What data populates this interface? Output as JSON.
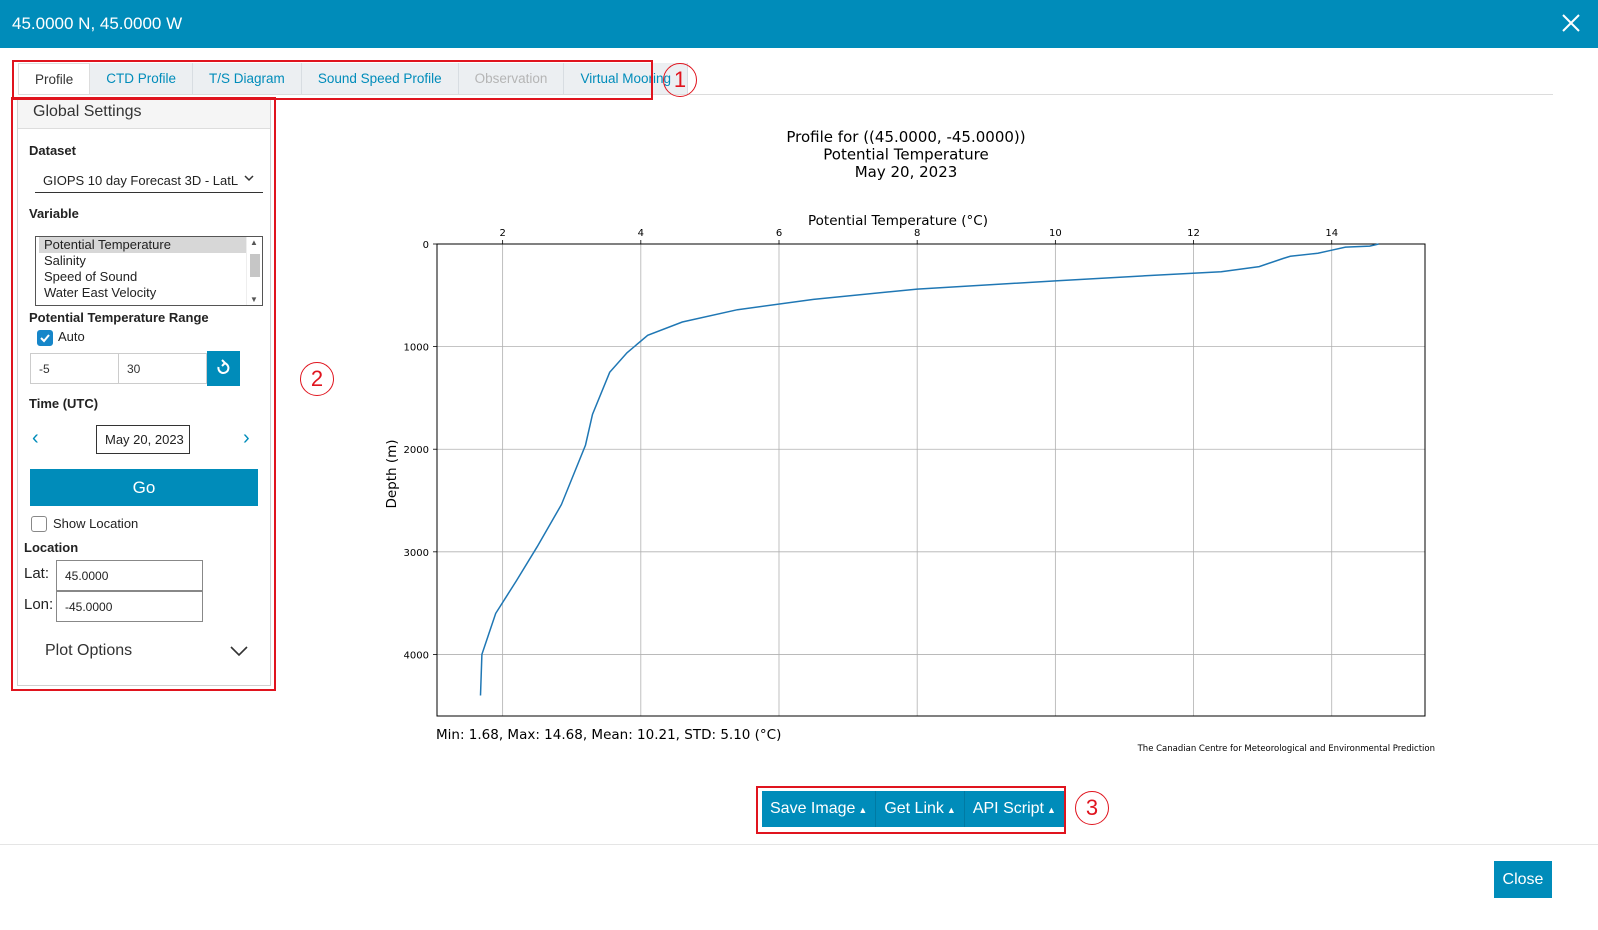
{
  "window": {
    "title": "45.0000 N, 45.0000 W",
    "close_icon": "close-icon"
  },
  "tabs": [
    {
      "label": "Profile",
      "state": "active"
    },
    {
      "label": "CTD Profile",
      "state": "normal"
    },
    {
      "label": "T/S Diagram",
      "state": "normal"
    },
    {
      "label": "Sound Speed Profile",
      "state": "normal"
    },
    {
      "label": "Observation",
      "state": "disabled"
    },
    {
      "label": "Virtual Mooring",
      "state": "normal"
    }
  ],
  "markers": [
    "1",
    "2",
    "3"
  ],
  "settings": {
    "header": "Global Settings",
    "dataset_label": "Dataset",
    "dataset_value": "GIOPS 10 day Forecast 3D - LatL",
    "variable_label": "Variable",
    "variables": [
      "Potential Temperature",
      "Salinity",
      "Speed of Sound",
      "Water East Velocity"
    ],
    "selected_variable": "Potential Temperature",
    "range_label": "Potential Temperature Range",
    "auto_label": "Auto",
    "auto_checked": true,
    "range_min": "-5",
    "range_max": "30",
    "time_label": "Time (UTC)",
    "date": "May 20, 2023",
    "go_label": "Go",
    "show_location_label": "Show Location",
    "show_location_checked": false,
    "location_label": "Location",
    "lat_label": "Lat:",
    "lat_value": "45.0000",
    "lon_label": "Lon:",
    "lon_value": "-45.0000",
    "plot_options_label": "Plot Options"
  },
  "chart_data": {
    "type": "line",
    "title_lines": [
      "Profile for ((45.0000, -45.0000))",
      "Potential Temperature",
      "May 20, 2023"
    ],
    "xlabel": "Potential Temperature (°C)",
    "ylabel": "Depth (m)",
    "x_axis_position": "top",
    "y_inverted": true,
    "xlim": [
      1.05,
      15.35
    ],
    "ylim": [
      0,
      4600
    ],
    "xticks": [
      2,
      4,
      6,
      8,
      10,
      12,
      14
    ],
    "yticks": [
      0,
      1000,
      2000,
      3000,
      4000
    ],
    "grid": true,
    "color": "#1f77b4",
    "x": [
      14.68,
      14.55,
      14.2,
      14.0,
      13.8,
      13.4,
      13.3,
      12.95,
      12.4,
      11.3,
      10.0,
      8.0,
      6.5,
      5.4,
      4.6,
      4.1,
      3.8,
      3.55,
      3.3,
      3.2,
      2.85,
      2.5,
      2.2,
      1.9,
      1.8,
      1.7,
      1.68
    ],
    "y": [
      0,
      20,
      30,
      60,
      90,
      120,
      140,
      220,
      270,
      310,
      360,
      440,
      540,
      640,
      760,
      890,
      1060,
      1250,
      1660,
      1960,
      2540,
      2950,
      3280,
      3600,
      3800,
      4000,
      4400
    ],
    "stats": "Min: 1.68, Max: 14.68, Mean: 10.21, STD: 5.10 (°C)",
    "credit": "The Canadian Centre for Meteorological and Environmental Prediction"
  },
  "actions": {
    "save_image": "Save Image",
    "get_link": "Get Link",
    "api_script": "API Script",
    "close": "Close"
  }
}
